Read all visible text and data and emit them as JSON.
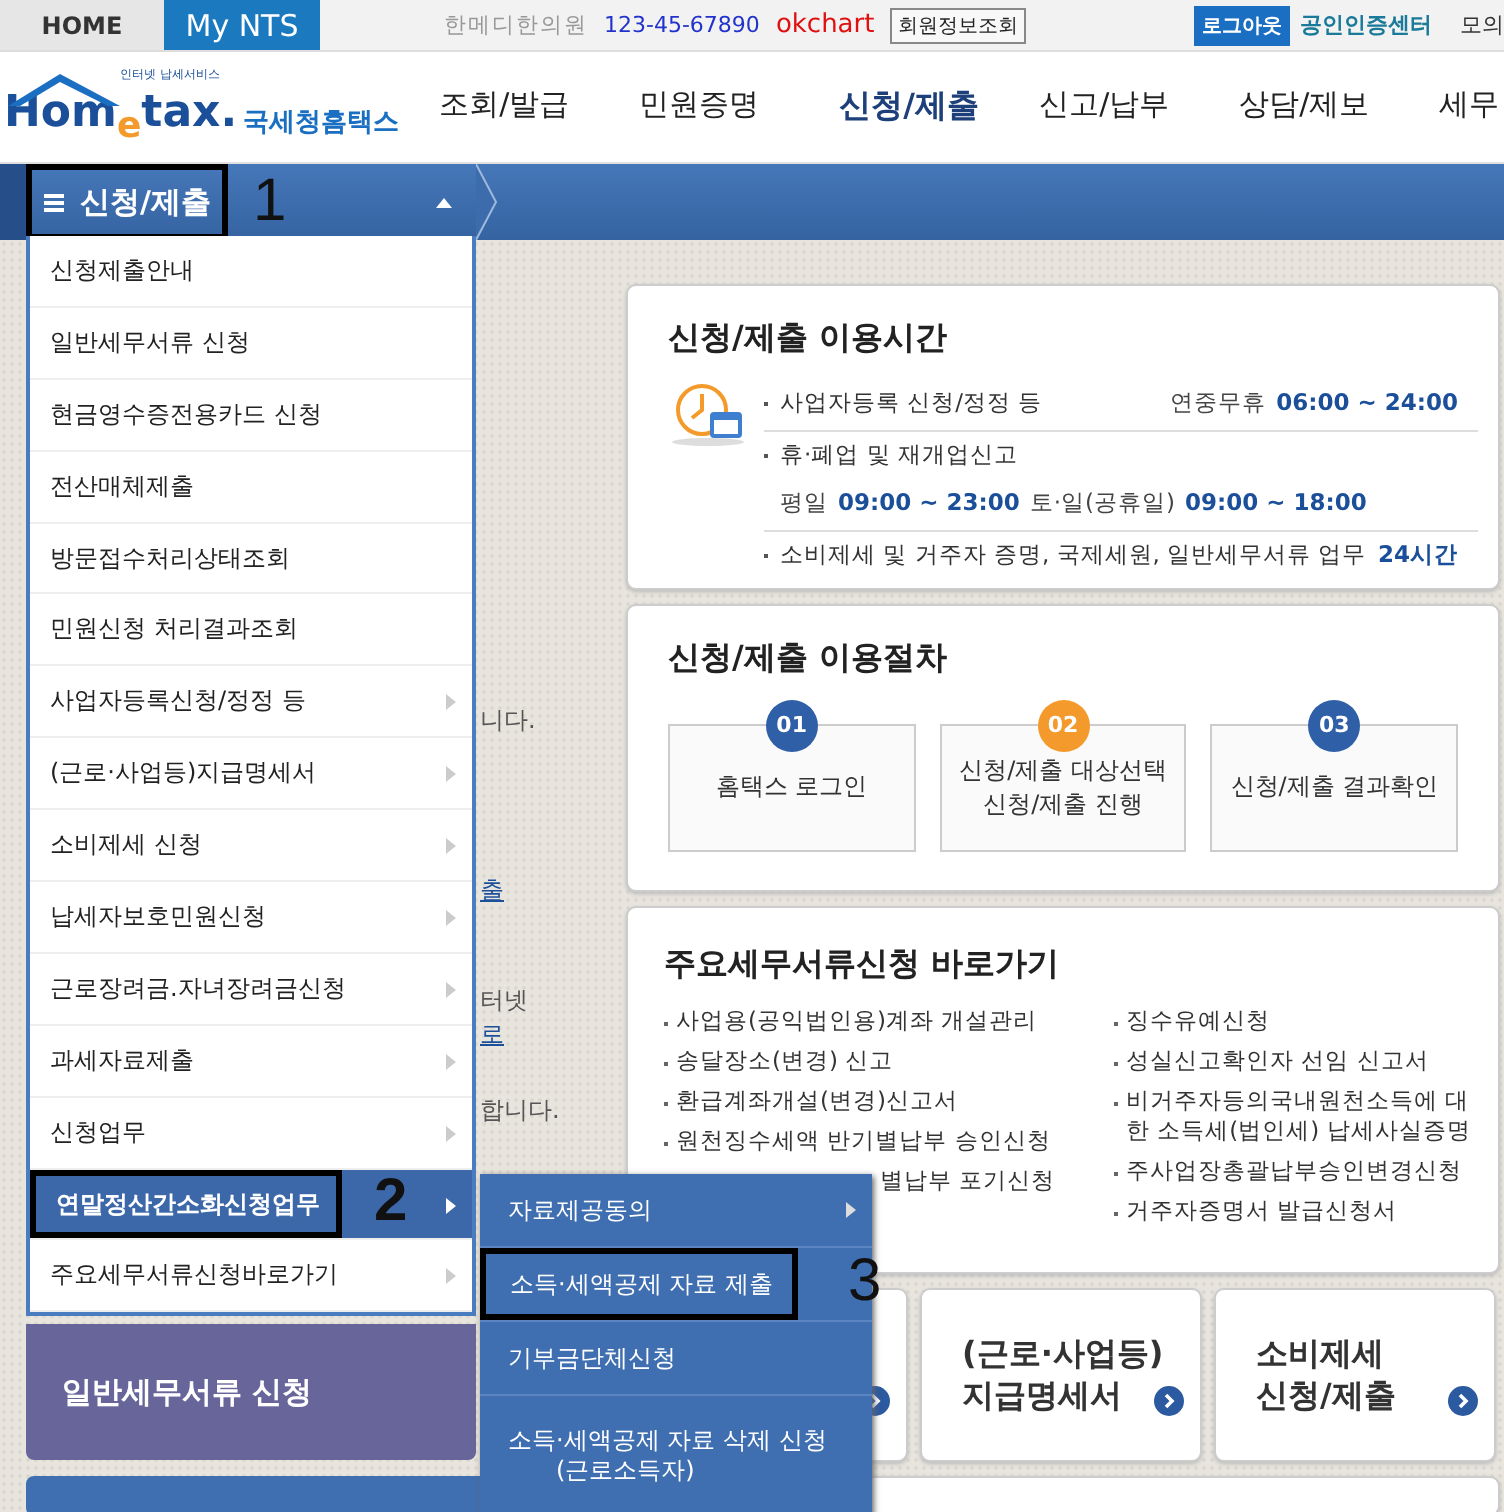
{
  "top_bar": {
    "tabs": [
      {
        "label": "HOME",
        "selected": false
      },
      {
        "label": "My NTS",
        "selected": true
      }
    ],
    "user": {
      "name": "한메디한의원",
      "business_number": "123-45-67890",
      "user_id": "okchart",
      "info_button": "회원정보조회"
    },
    "logout_button": "로그아웃",
    "cert_link": "공인인증센터",
    "cut_link": "모의"
  },
  "header": {
    "logo": {
      "tagline": "인터넷 납세서비스",
      "wordmark": "Hom$_{e}$tax.",
      "name": "국세청홈택스"
    },
    "nav": [
      {
        "label": "조회/발급",
        "selected": false
      },
      {
        "label": "민원증명",
        "selected": false
      },
      {
        "label": "신청/제출",
        "selected": true
      },
      {
        "label": "신고/납부",
        "selected": false
      },
      {
        "label": "상담/제보",
        "selected": false
      },
      {
        "label": "세무",
        "selected": false
      }
    ]
  },
  "menu_bar": {
    "title": "신청/제출",
    "expanded": true,
    "annotation": "1"
  },
  "menu": {
    "items": [
      {
        "label": "신청제출안내",
        "has_submenu": false,
        "selected": false
      },
      {
        "label": "일반세무서류 신청",
        "has_submenu": false,
        "selected": false
      },
      {
        "label": "현금영수증전용카드 신청",
        "has_submenu": false,
        "selected": false
      },
      {
        "label": "전산매체제출",
        "has_submenu": false,
        "selected": false
      },
      {
        "label": "방문접수처리상태조회",
        "has_submenu": false,
        "selected": false
      },
      {
        "label": "민원신청 처리결과조회",
        "has_submenu": false,
        "selected": false
      },
      {
        "label": "사업자등록신청/정정 등",
        "has_submenu": true,
        "selected": false
      },
      {
        "label": "(근로·사업등)지급명세서",
        "has_submenu": true,
        "selected": false
      },
      {
        "label": "소비제세 신청",
        "has_submenu": true,
        "selected": false
      },
      {
        "label": "납세자보호민원신청",
        "has_submenu": true,
        "selected": false
      },
      {
        "label": "근로장려금.자녀장려금신청",
        "has_submenu": true,
        "selected": false
      },
      {
        "label": "과세자료제출",
        "has_submenu": true,
        "selected": false
      },
      {
        "label": "신청업무",
        "has_submenu": true,
        "selected": false
      },
      {
        "label": "연말정산간소화신청업무",
        "has_submenu": true,
        "selected": true,
        "annotation": "2"
      },
      {
        "label": "주요세무서류신청바로가기",
        "has_submenu": true,
        "selected": false
      }
    ]
  },
  "submenu": {
    "items": [
      {
        "label": "자료제공동의",
        "has_submenu": true
      },
      {
        "label": "소득·세액공제 자료 제출",
        "has_submenu": false,
        "annotation": "3"
      },
      {
        "label": "기부금단체신청",
        "has_submenu": false
      },
      {
        "label": "소득·세액공제 자료 삭제 신청 　　(근로소득자)",
        "has_submenu": false
      }
    ]
  },
  "background_fragments": [
    {
      "text": "니다.",
      "kind": "text"
    },
    {
      "text": "출",
      "kind": "link"
    },
    {
      "text": "터넷",
      "kind": "text"
    },
    {
      "text": "로",
      "kind": "link"
    },
    {
      "text": "합니다.",
      "kind": "text"
    }
  ],
  "left_card": {
    "label": "일반세무서류 신청"
  },
  "hours_card": {
    "title": "신청/제출 이용시간",
    "rows": [
      {
        "label": "사업자등록 신청/정정 등",
        "kind": "inline",
        "schedule": [
          {
            "day": "연중무휴",
            "time": "06:00 ~ 24:00"
          }
        ]
      },
      {
        "label": "휴·폐업 및 재개업신고",
        "kind": "below",
        "schedule": [
          {
            "day": "평일",
            "time": "09:00 ~ 23:00"
          },
          {
            "day": "토·일(공휴일)",
            "time": "09:00 ~ 18:00"
          }
        ]
      },
      {
        "label": "소비제세 및 거주자 증명, 국제세원, 일반세무서류 업무",
        "kind": "inline",
        "schedule": [
          {
            "time": "24시간"
          }
        ]
      }
    ]
  },
  "steps_card": {
    "title": "신청/제출 이용절차",
    "steps": [
      {
        "number": "01",
        "lines": [
          "홈택스 로그인"
        ],
        "color": "#2f5fa6"
      },
      {
        "number": "02",
        "lines": [
          "신청/제출 대상선택",
          "신청/제출 진행"
        ],
        "color": "#f49a2c"
      },
      {
        "number": "03",
        "lines": [
          "신청/제출 결과확인"
        ],
        "color": "#2f5fa6"
      }
    ]
  },
  "shortcuts_card": {
    "title": "주요세무서류신청 바로가기",
    "left": [
      {
        "text": "사업용(공익법인용)계좌 개설관리",
        "clipped": false
      },
      {
        "text": "송달장소(변경) 신고",
        "clipped": false
      },
      {
        "text": "환급계좌개설(변경)신고서",
        "clipped": false
      },
      {
        "text": "원천징수세액 반기별납부 승인신청",
        "clipped": false
      },
      {
        "text": "별납부 포기신청",
        "clipped": true
      }
    ],
    "right": [
      {
        "text": "징수유예신청",
        "clipped": false
      },
      {
        "text": "성실신고확인자 선임 신고서",
        "clipped": false
      },
      {
        "text": "비거주자등의국내원천소득에 대한 소득세(법인세) 납세사실증명",
        "clipped": false
      },
      {
        "text": "주사업장총괄납부승인변경신청",
        "clipped": false
      },
      {
        "text": "거주자증명서 발급신청서",
        "clipped": false
      }
    ]
  },
  "quick_cards": [
    {
      "lines": [
        "(근로·사업등)",
        "지급명세서"
      ]
    },
    {
      "lines": [
        "소비제세",
        "신청/제출"
      ]
    }
  ]
}
